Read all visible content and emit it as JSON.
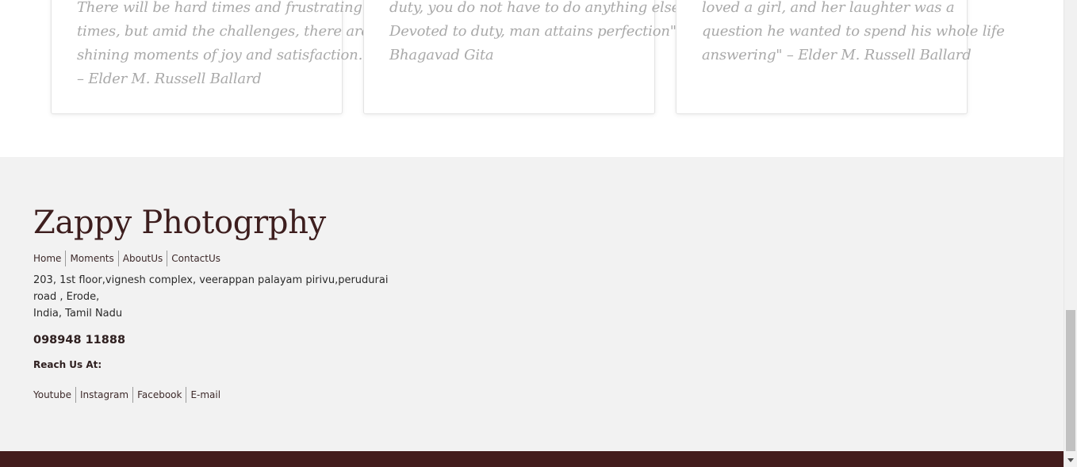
{
  "quotes": [
    {
      "lines": [
        "There will be hard times and frustrating",
        "times, but amid the challenges, there are",
        "shining moments of joy and satisfaction.”",
        "– Elder M. Russell Ballard"
      ]
    },
    {
      "lines": [
        "duty, you do not have to do anything else.",
        "Devoted to duty, man attains perfection\"--",
        "Bhagavad Gita"
      ]
    },
    {
      "lines": [
        "loved a girl, and her laughter was a",
        "question he wanted to spend his whole life",
        "answering\" – Elder M. Russell Ballard"
      ]
    }
  ],
  "footer": {
    "brand": "Zappy Photogrphy",
    "nav": [
      "Home",
      "Moments",
      "AboutUs",
      "ContactUs"
    ],
    "address_line1": "203, 1st floor,vignesh complex, veerappan palayam pirivu,perudurai road , Erode,",
    "address_line2": "India, Tamil Nadu",
    "phone": "098948 11888",
    "reach_label": "Reach Us At:",
    "social": [
      "Youtube",
      "Instagram",
      "Facebook",
      "E-mail"
    ]
  },
  "colors": {
    "brand": "#3d1e1e",
    "footer_bg": "#f2f2f2",
    "bottom_bar": "#431c1c",
    "quote_text": "#a9a9a9"
  }
}
